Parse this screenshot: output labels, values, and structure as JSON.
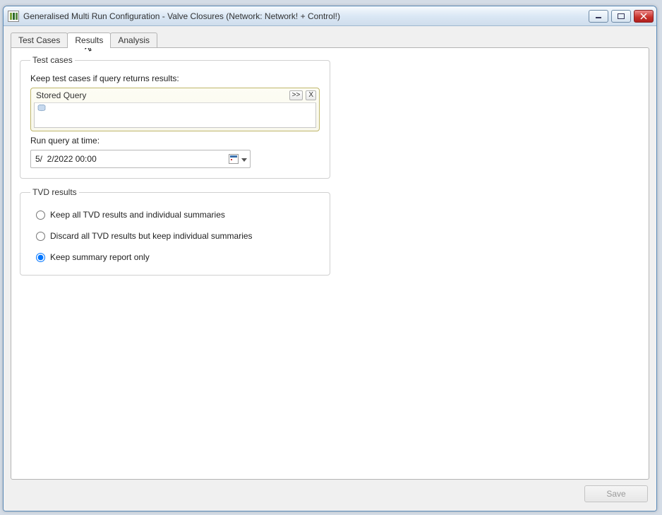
{
  "window": {
    "title": "Generalised Multi Run Configuration  - Valve Closures (Network: Network! + Control!)"
  },
  "tabs": {
    "test_cases": "Test Cases",
    "results": "Results",
    "analysis": "Analysis",
    "active": "Results"
  },
  "group_testcases": {
    "legend": "Test cases",
    "keep_label": "Keep test cases if query returns results:",
    "stored_query": {
      "title": "Stored Query",
      "expand_btn": ">>",
      "clear_btn": "X",
      "value": ""
    },
    "run_at_label": "Run query at time:",
    "run_at_value": "5/  2/2022 00:00"
  },
  "group_tvd": {
    "legend": "TVD results",
    "options": {
      "keep_all": "Keep all TVD results and individual summaries",
      "discard": "Discard all TVD results but keep individual summaries",
      "summary_only": "Keep summary report only"
    },
    "selected": "summary_only"
  },
  "buttons": {
    "save": "Save"
  }
}
